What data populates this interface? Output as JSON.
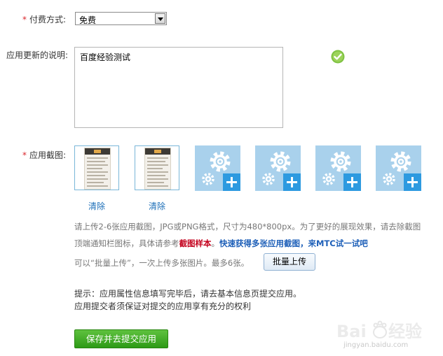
{
  "payment": {
    "required_mark": "*",
    "label": "付费方式:",
    "selected": "免费"
  },
  "update_notes": {
    "label": "应用更新的说明:",
    "value": "百度经验测试"
  },
  "screenshots": {
    "required_mark": "*",
    "label": "应用截图:",
    "clear_label": "清除",
    "hint_line1": "请上传2-6张应用截图，JPG或PNG格式，尺寸为480*800px。为了更好的展现效果，请去除截图",
    "hint_line2_prefix": "顶端通知栏图标，具体请参考",
    "sample_link": "截图样本",
    "punct": "。",
    "quick_link": "快速获得多张应用截图，来MTC试一试吧",
    "batch_hint": "可以“批量上传”，一次上传多张图片。最多6张。",
    "batch_button": "批量上传"
  },
  "tips": {
    "line1": "提示：应用属性信息填写完毕后，请去基本信息页提交应用。",
    "line2": "应用提交者须保证对提交的应用享有充分的权利"
  },
  "submit": {
    "label": "保存并去提交应用"
  },
  "watermark": {
    "sub": "jingyan.baidu.com"
  },
  "colors": {
    "required": "#d9262c",
    "link": "#1d6fb8",
    "submit": "#3aa61e",
    "tile": "#a9d1ec"
  }
}
